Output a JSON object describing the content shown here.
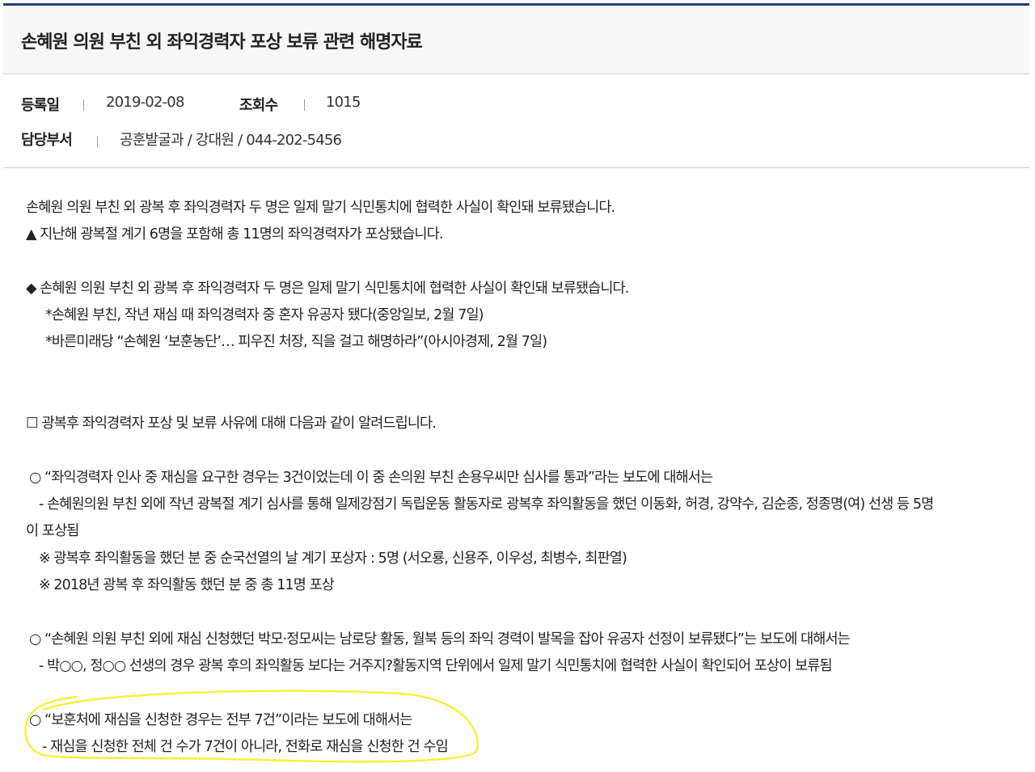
{
  "header": {
    "title": "손혜원 의원 부친 외 좌익경력자 포상 보류 관련 해명자료"
  },
  "meta": {
    "registered_label": "등록일",
    "registered_value": "2019-02-08",
    "views_label": "조회수",
    "views_value": "1015",
    "department_label": "담당부서",
    "department_value": "공훈발굴과 / 강대원 / 044-202-5456"
  },
  "body": {
    "lines": [
      "손혜원 의원 부친 외 광복 후 좌익경력자 두 명은 일제 말기 식민통치에 협력한 사실이 확인돼 보류됐습니다.",
      "▲ 지난해 광복절 계기 6명을 포함해 총 11명의 좌익경력자가 포상됐습니다.",
      "◆ 손혜원 의원 부친 외 광복 후 좌익경력자 두 명은 일제 말기 식민통치에 협력한 사실이 확인돼 보류됐습니다.",
      "*손혜원 부친, 작년 재심 때 좌익경력자 중 혼자 유공자 됐다(중앙일보, 2월 7일)",
      "*바른미래당 “손혜원 ‘보훈농단’… 피우진 처장, 직을 걸고 해명하라”(아시아경제, 2월 7일)",
      "☐ 광복후 좌익경력자 포상 및 보류 사유에 대해 다음과 같이 알려드립니다.",
      "○ “좌익경력자 인사 중 재심을 요구한 경우는 3건이었는데 이 중 손의원 부친 손용우씨만 심사를 통과”라는 보도에 대해서는",
      "- 손혜원의원 부친 외에 작년 광복절 계기 심사를 통해 일제강점기 독립운동 활동자로 광복후 좌익활동을 했던 이동화, 허경, 강약수, 김순종, 정종명(여) 선생 등 5명",
      "이 포상됨",
      "※ 광복후 좌익활동을 했던 분 중 순국선열의 날 계기 포상자 : 5명 (서오룡, 신용주, 이우성, 최병수, 최판열)",
      "※ 2018년 광복 후 좌익활동 했던 분 중 총 11명 포상",
      "○ “손혜원 의원 부친 외에 재심 신청했던 박모·정모씨는 남로당 활동, 월북 등의 좌익 경력이 발목을 잡아 유공자 선정이 보류됐다”는 보도에 대해서는",
      "- 박○○, 정○○ 선생의 경우 광복 후의 좌익활동 보다는 거주지?활동지역 단위에서 일제 말기 식민통치에 협력한 사실이 확인되어 포상이 보류됨",
      "○ “보훈처에 재심을 신청한 경우는 전부 7건”이라는 보도에 대해서는",
      "- 재심을 신청한 전체 건 수가 7건이 아니라, 전화로 재심을 신청한 건 수임"
    ]
  },
  "colors": {
    "header_accent": "#1f3f7f",
    "highlight_marker": "#f5f03a"
  }
}
